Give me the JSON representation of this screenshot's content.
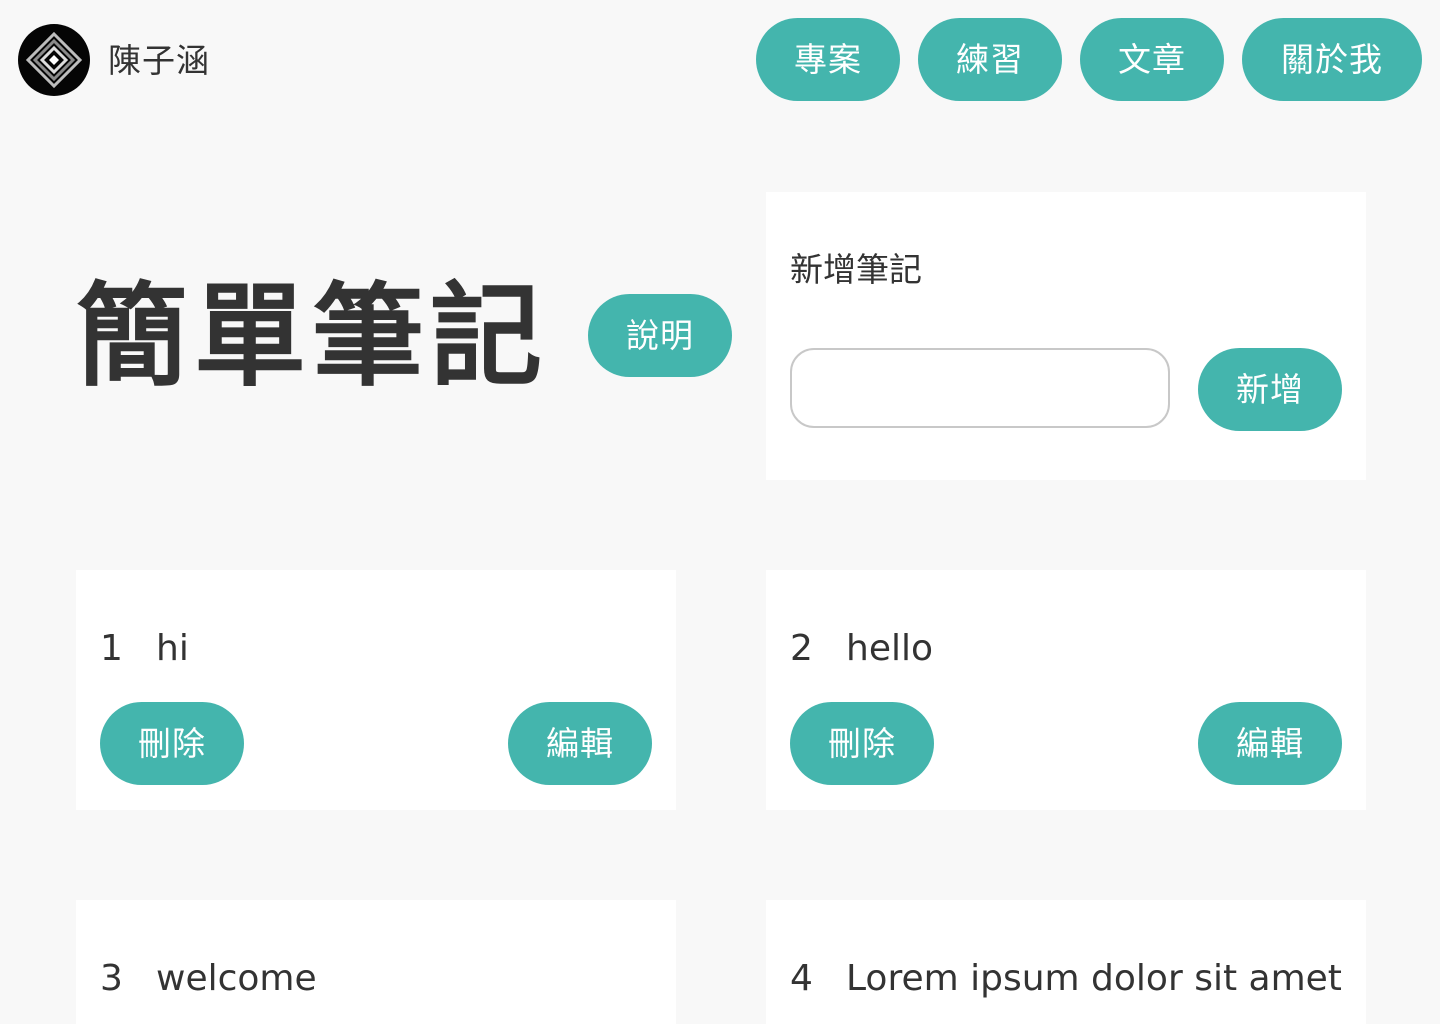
{
  "header": {
    "logo": "diamond-logo",
    "site_name": "陳子涵",
    "nav": [
      {
        "label": "專案"
      },
      {
        "label": "練習"
      },
      {
        "label": "文章"
      },
      {
        "label": "關於我"
      }
    ]
  },
  "main": {
    "title": "簡單筆記",
    "help_button": "說明"
  },
  "add_card": {
    "title": "新增筆記",
    "input_value": "",
    "input_placeholder": "",
    "add_button": "新增"
  },
  "notes": [
    {
      "id": "1",
      "text": "hi",
      "delete_label": "刪除",
      "edit_label": "編輯"
    },
    {
      "id": "2",
      "text": "hello",
      "delete_label": "刪除",
      "edit_label": "編輯"
    },
    {
      "id": "3",
      "text": "welcome"
    },
    {
      "id": "4",
      "text": "Lorem ipsum dolor sit amet"
    }
  ],
  "colors": {
    "accent": "#44b5ad",
    "background": "#f8f8f8",
    "card": "#ffffff",
    "text": "#333333"
  }
}
